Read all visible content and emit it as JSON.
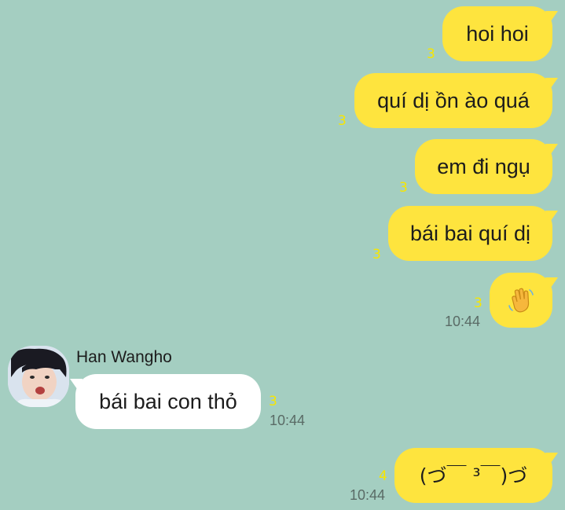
{
  "messages": [
    {
      "text": "hoi hoi",
      "unread": "3"
    },
    {
      "text": "quí dị ồn ào quá",
      "unread": "3"
    },
    {
      "text": "em đi ngụ",
      "unread": "3"
    },
    {
      "text": "bái bai quí dị",
      "unread": "3"
    },
    {
      "emoji": "waving-hand",
      "unread": "3",
      "time": "10:44"
    },
    {
      "sender": "Han Wangho",
      "text": "bái bai con thỏ",
      "unread": "3",
      "time": "10:44"
    },
    {
      "text": "(づ￣ ³￣)づ",
      "unread": "4",
      "time": "10:44"
    }
  ],
  "colors": {
    "background": "#a4cec1",
    "my_bubble": "#fee43e",
    "their_bubble": "#ffffff",
    "unread_count": "#f7e600",
    "timestamp": "#5a6b66"
  }
}
